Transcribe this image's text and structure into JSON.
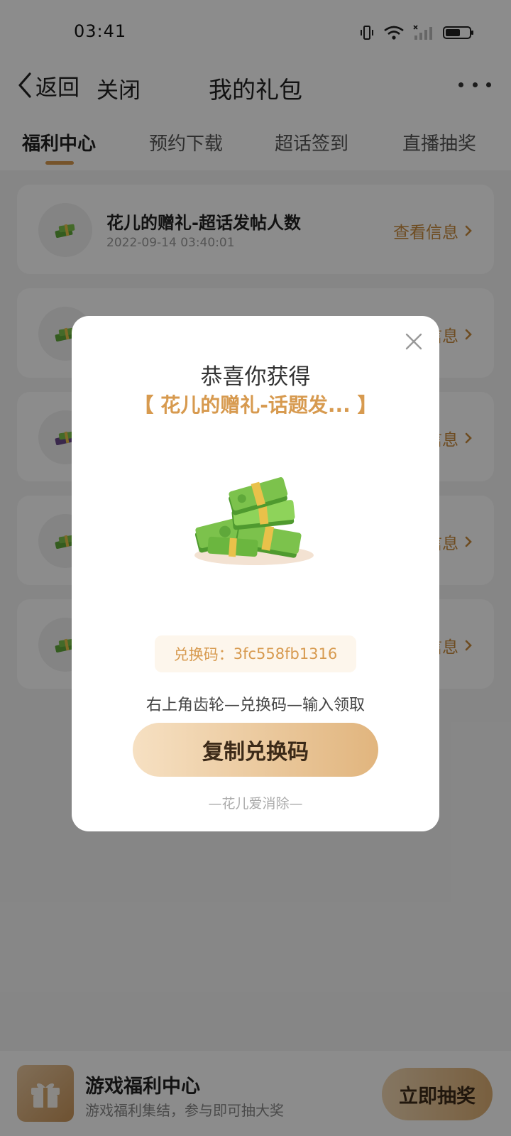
{
  "status_bar": {
    "time": "03:41",
    "icons": [
      "vibrate-icon",
      "wifi-icon",
      "signal-icon",
      "battery-icon"
    ]
  },
  "header": {
    "back_label": "返回",
    "close_label": "关闭",
    "title": "我的礼包"
  },
  "tabs": [
    {
      "label": "福利中心",
      "active": true
    },
    {
      "label": "预约下载",
      "active": false
    },
    {
      "label": "超话签到",
      "active": false
    },
    {
      "label": "直播抽奖",
      "active": false
    }
  ],
  "list": {
    "items": [
      {
        "title": "花儿的赠礼-超话发帖人数",
        "time": "2022-09-14 03:40:01",
        "action": "查看信息"
      },
      {
        "title": "",
        "time": "",
        "action": "查看信息"
      },
      {
        "title": "",
        "time": "",
        "action": "查看信息"
      },
      {
        "title": "",
        "time": "",
        "action": "查看信息"
      },
      {
        "title": "",
        "time": "",
        "action": "查看信息"
      }
    ]
  },
  "bottom_bar": {
    "title": "游戏福利中心",
    "subtitle": "游戏福利集结，参与即可抽大奖",
    "button_label": "立即抽奖"
  },
  "modal": {
    "heading": "恭喜你获得",
    "prize_name": "【 花儿的赠礼-话题发... 】",
    "code_label": "兑换码：",
    "code": "3fc558fb1316",
    "instruction": "右上角齿轮—兑换码—输入领取",
    "copy_button": "复制兑换码",
    "footer": "—花儿爱消除—"
  },
  "colors": {
    "accent": "#d79a4f",
    "link": "#c98a3c",
    "button_gradient_start": "#f6e0c2",
    "button_gradient_end": "#e1b57e",
    "overlay": "rgba(0,0,0,0.45)"
  }
}
